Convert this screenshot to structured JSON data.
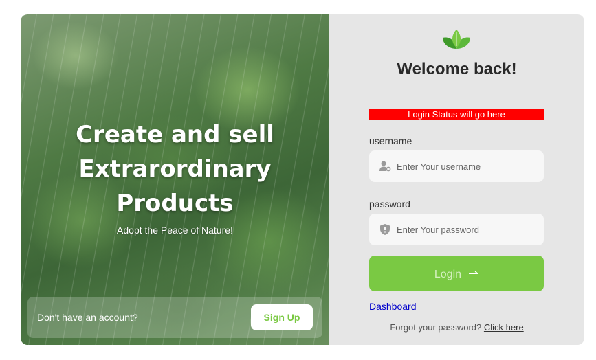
{
  "hero": {
    "title": "Create and sell Extrarordinary Products",
    "subtitle": "Adopt the Peace of Nature!",
    "signup_prompt": "Don't have an account?",
    "signup_button": "Sign Up"
  },
  "login": {
    "heading": "Welcome back!",
    "status": "Login Status will go here",
    "username_label": "username",
    "username_placeholder": "Enter Your username",
    "password_label": "password",
    "password_placeholder": "Enter Your password",
    "login_button": "Login",
    "dashboard_link": "Dashboard",
    "forgot_text": "Forgot your password?",
    "forgot_link": "Click here"
  },
  "icons": {
    "logo": "leaf-logo",
    "username": "user-key-icon",
    "password": "shield-icon",
    "login_arrow": "arrow-right-icon"
  },
  "colors": {
    "accent": "#7ac943",
    "status_bg": "#ff0000",
    "panel_bg": "#e6e6e6",
    "link": "#0000cc"
  }
}
